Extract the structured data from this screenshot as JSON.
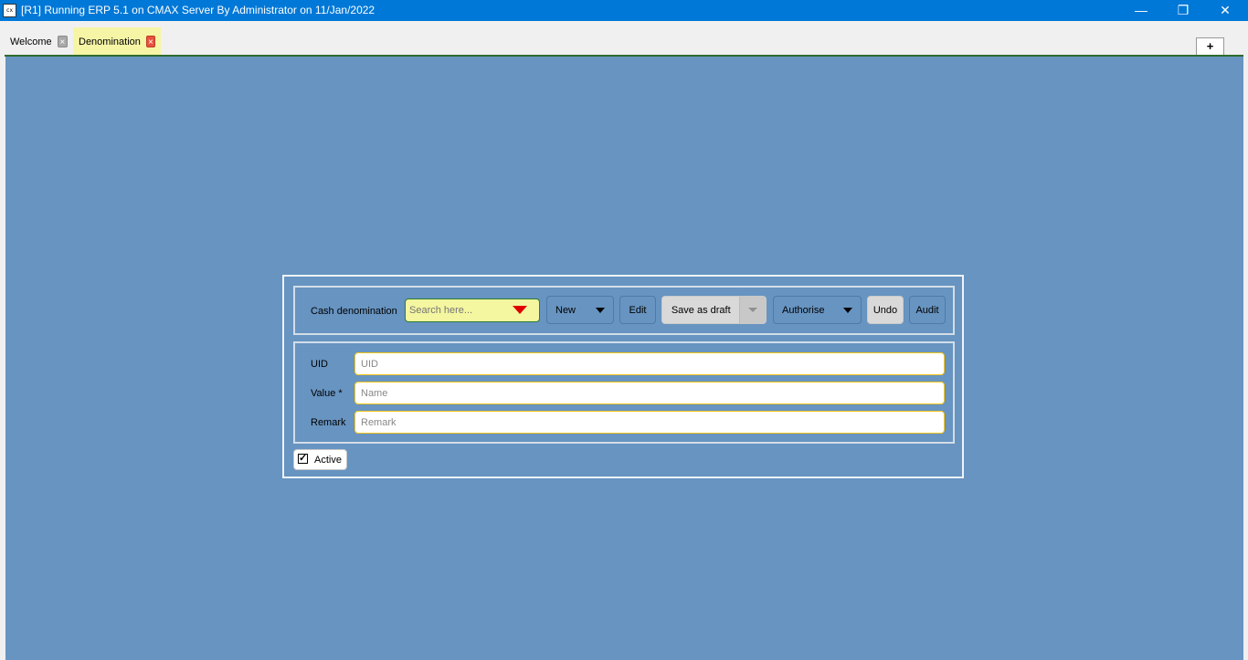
{
  "window": {
    "title": "[R1] Running ERP 5.1 on CMAX Server By Administrator on 11/Jan/2022",
    "app_icon": "cx",
    "minimize_icon": "—",
    "restore_icon": "❐",
    "close_icon": "✕"
  },
  "tabs": [
    {
      "label": "Welcome",
      "close": "×",
      "active": false
    },
    {
      "label": "Denomination",
      "close": "×",
      "active": true
    }
  ],
  "add_tab_label": "+",
  "toolbar": {
    "entity_label": "Cash denomination",
    "search_placeholder": "Search here...",
    "new_label": "New",
    "edit_label": "Edit",
    "save_label": "Save as draft",
    "authorise_label": "Authorise",
    "undo_label": "Undo",
    "audit_label": "Audit"
  },
  "fields": {
    "uid_label": "UID",
    "uid_placeholder": "UID",
    "value_label": "Value *",
    "value_placeholder": "Name",
    "remark_label": "Remark",
    "remark_placeholder": "Remark"
  },
  "active": {
    "label": "Active",
    "checked": true,
    "check_mark": "✓"
  },
  "colors": {
    "title_bar": "#0078d7",
    "canvas": "#6794c1",
    "search_bg": "#f4f6a0",
    "active_tab_bg": "#f6f5a6",
    "field_border": "#f5c518",
    "search_caret": "#e00000"
  }
}
